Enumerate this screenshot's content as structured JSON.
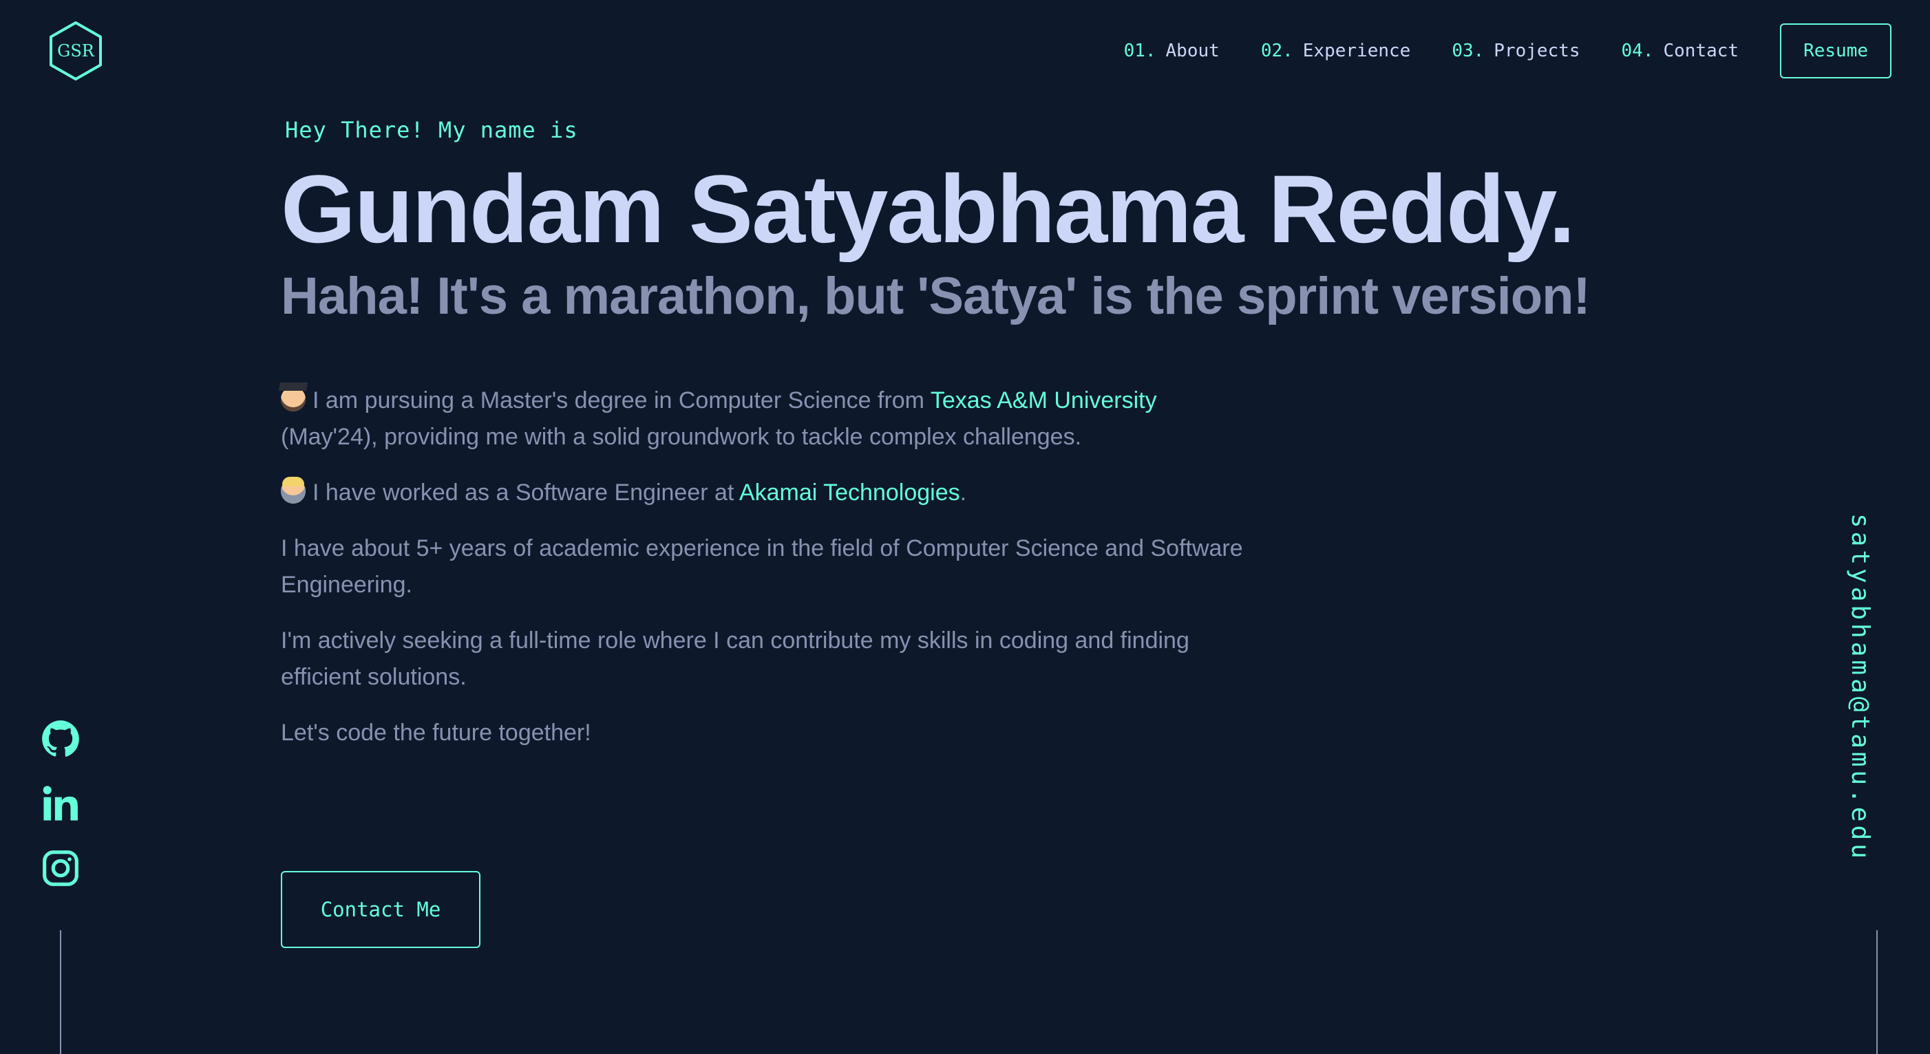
{
  "logo": {
    "text": "GSR",
    "icon": "hexagon-logo-icon"
  },
  "nav": {
    "items": [
      {
        "num": "01.",
        "label": "About"
      },
      {
        "num": "02.",
        "label": "Experience"
      },
      {
        "num": "03.",
        "label": "Projects"
      },
      {
        "num": "04.",
        "label": "Contact"
      }
    ],
    "resume_label": "Resume"
  },
  "hero": {
    "greeting": "Hey There! My name is",
    "name": "Gundam Satyabhama Reddy.",
    "tagline": "Haha! It's a marathon, but 'Satya' is the sprint version!",
    "bio": {
      "p1_before": "I am pursuing a Master's degree in Computer Science from ",
      "p1_link": "Texas A&M University",
      "p1_after": " (May'24), providing me with a solid groundwork to tackle complex challenges.",
      "p2_before": "I have worked as a Software Engineer at ",
      "p2_link": "Akamai Technologies",
      "p2_after": ".",
      "p3": "I have about 5+ years of academic experience in the field of Computer Science and Software Engineering.",
      "p4": "I'm actively seeking a full-time role where I can contribute my skills in coding and finding efficient solutions.",
      "p5": "Let's code the future together!"
    },
    "contact_label": "Contact Me"
  },
  "socials": [
    {
      "icon": "github-icon"
    },
    {
      "icon": "linkedin-icon"
    },
    {
      "icon": "instagram-icon"
    }
  ],
  "email": "satyabhama@tamu.edu",
  "colors": {
    "background": "#0e182b",
    "accent": "#64ffda",
    "heading": "#ccd6f6",
    "body": "#8892b0"
  }
}
